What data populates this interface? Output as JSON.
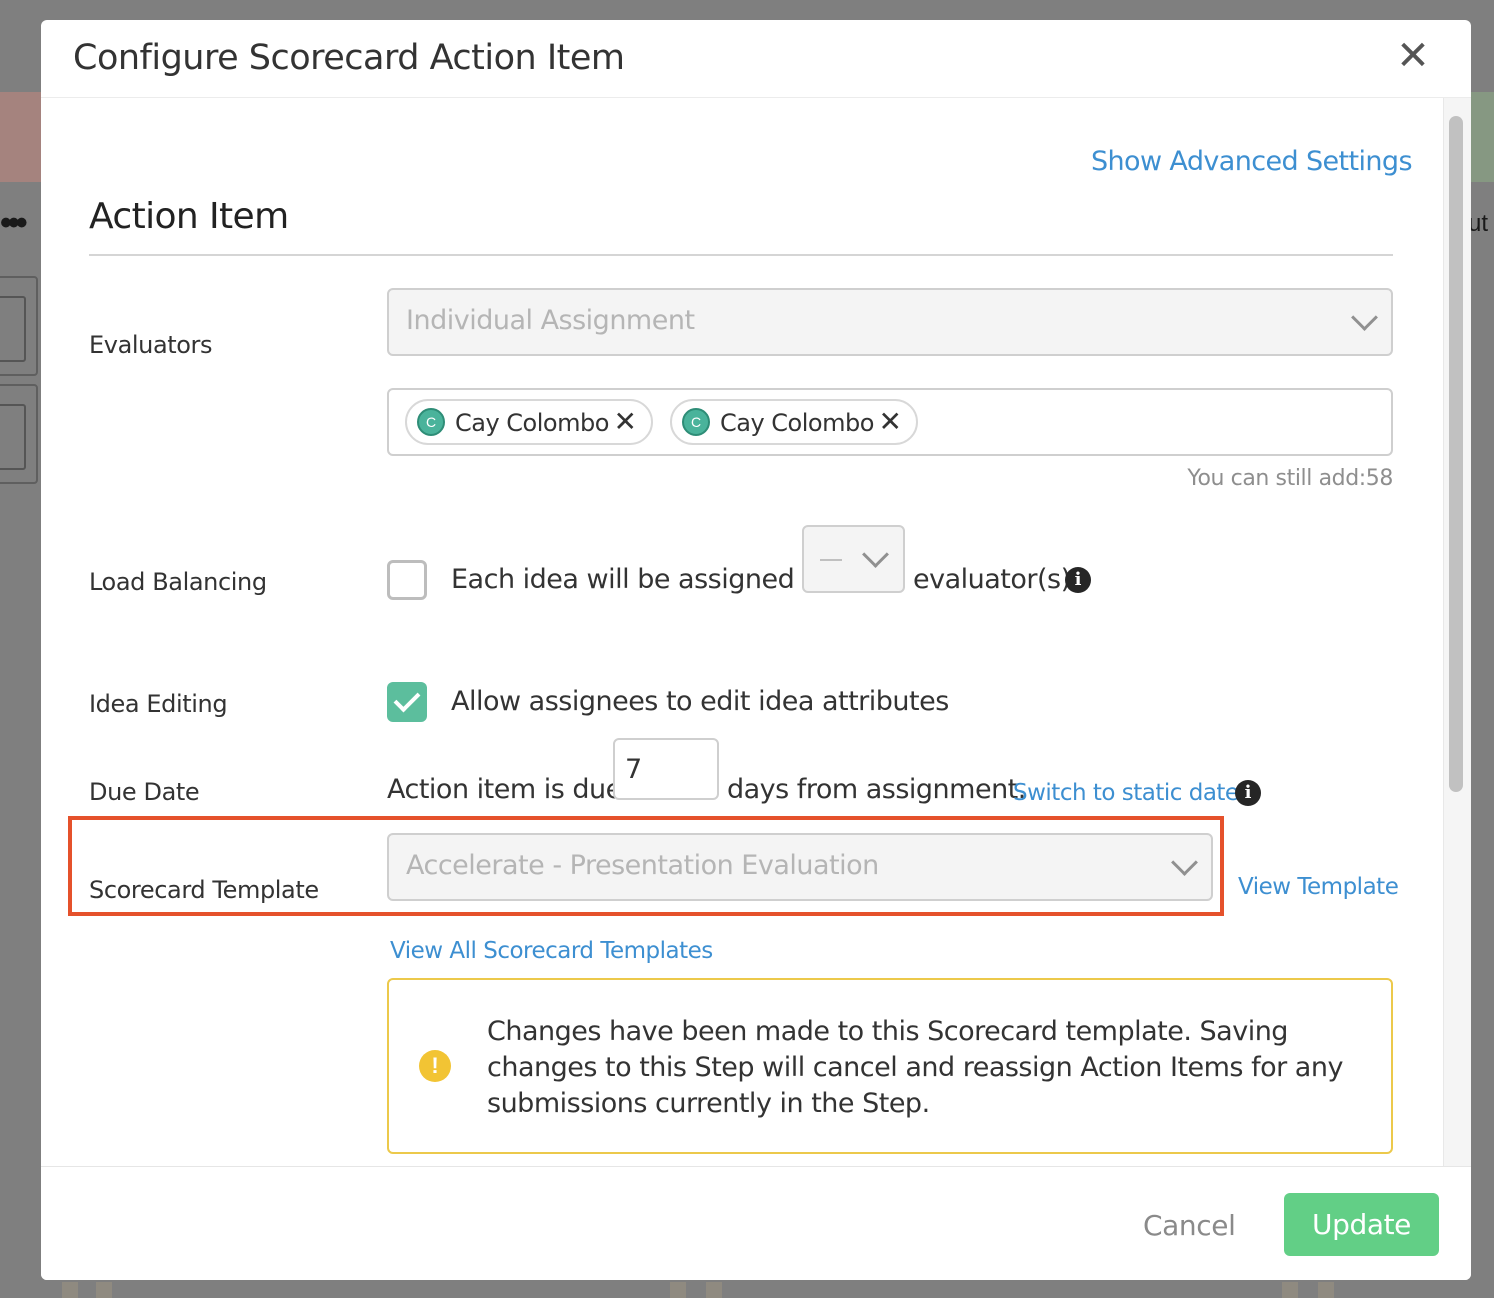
{
  "modal": {
    "title": "Configure Scorecard Action Item",
    "close_icon": "close-icon",
    "advanced_link": "Show Advanced Settings",
    "section_title": "Action Item"
  },
  "evaluators": {
    "label": "Evaluators",
    "select_value": "Individual Assignment",
    "tags": [
      {
        "initial": "C",
        "name": "Cay Colombo",
        "remove_icon": "close-icon"
      },
      {
        "initial": "C",
        "name": "Cay Colombo",
        "remove_icon": "close-icon"
      }
    ],
    "still_add": "You can still add:58"
  },
  "load_balancing": {
    "label": "Load Balancing",
    "checked": false,
    "text_before": "Each idea will be assigned to",
    "select_value": "–",
    "text_after": "evaluator(s)",
    "info_icon": "info-icon"
  },
  "idea_editing": {
    "label": "Idea Editing",
    "checked": true,
    "text": "Allow assignees to edit idea attributes"
  },
  "due_date": {
    "label": "Due Date",
    "text_before": "Action item is due",
    "days": "7",
    "text_after": "days from assignment.",
    "switch_link": "Switch to static date",
    "info_icon": "info-icon"
  },
  "scorecard_template": {
    "label": "Scorecard Template",
    "select_value": "Accelerate - Presentation Evaluation",
    "view_template": "View Template",
    "view_all": "View All Scorecard Templates",
    "highlight_color": "#e5512b"
  },
  "warning": {
    "icon": "warning-icon",
    "text": "Changes have been made to this Scorecard template. Saving changes to this Step will cancel and reassign Action Items for any submissions currently in the Step.",
    "border_color": "#ecc94b"
  },
  "footer": {
    "cancel": "Cancel",
    "update": "Update",
    "update_color": "#62cf86"
  },
  "background": {
    "dots": "•••",
    "partial_text": "ut"
  }
}
